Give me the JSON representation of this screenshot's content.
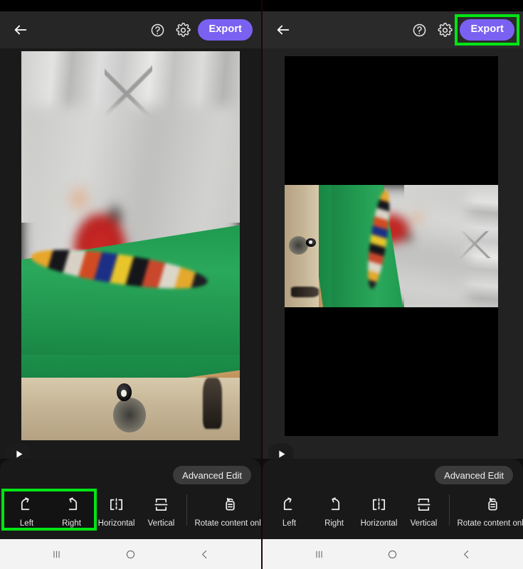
{
  "app": {
    "accent_purple": "#7B61F2",
    "highlight_green": "#00E414",
    "sheet_bg": "#191919"
  },
  "panels": [
    {
      "id": "before",
      "appbar": {
        "back_icon": "arrow-left-icon",
        "help_icon": "help-circle-icon",
        "settings_icon": "gear-icon",
        "export_label": "Export",
        "export_highlighted": false
      },
      "preview": {
        "orientation": "portrait",
        "letterboxed": false,
        "play_icon": "play-icon"
      },
      "sheet": {
        "advanced_edit_label": "Advanced Edit",
        "rotate_group_highlighted": true,
        "tools": [
          {
            "label": "Left",
            "icon": "rotate-left-icon"
          },
          {
            "label": "Right",
            "icon": "rotate-right-icon"
          },
          {
            "label": "Horizontal",
            "icon": "flip-horizontal-icon"
          },
          {
            "label": "Vertical",
            "icon": "flip-vertical-icon"
          },
          {
            "label": "Rotate content only",
            "icon": "rotate-content-icon"
          }
        ]
      },
      "navbar": {
        "recents_label": "|||",
        "home_label": "O",
        "back_label": "‹"
      }
    },
    {
      "id": "after",
      "appbar": {
        "back_icon": "arrow-left-icon",
        "help_icon": "help-circle-icon",
        "settings_icon": "gear-icon",
        "export_label": "Export",
        "export_highlighted": true
      },
      "preview": {
        "orientation": "landscape",
        "letterboxed": true,
        "play_icon": "play-icon"
      },
      "sheet": {
        "advanced_edit_label": "Advanced Edit",
        "rotate_group_highlighted": false,
        "tools": [
          {
            "label": "Left",
            "icon": "rotate-left-icon"
          },
          {
            "label": "Right",
            "icon": "rotate-right-icon"
          },
          {
            "label": "Horizontal",
            "icon": "flip-horizontal-icon"
          },
          {
            "label": "Vertical",
            "icon": "flip-vertical-icon"
          },
          {
            "label": "Rotate content only",
            "icon": "rotate-content-icon"
          }
        ]
      },
      "navbar": {
        "recents_label": "|||",
        "home_label": "O",
        "back_label": "‹"
      }
    }
  ]
}
